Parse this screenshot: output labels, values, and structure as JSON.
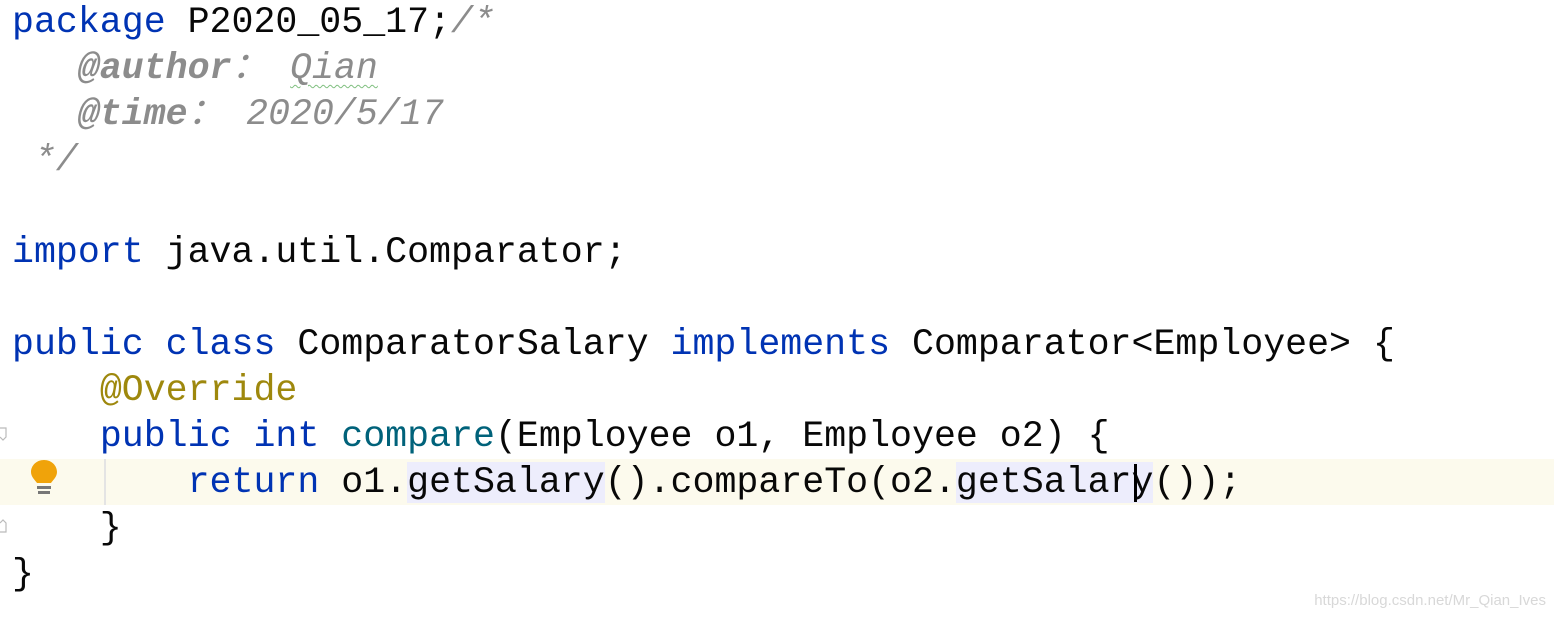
{
  "editor": {
    "lines": [
      [
        {
          "t": "package",
          "c": "kw"
        },
        {
          "t": " P2020_05_17;"
        },
        {
          "t": "/*",
          "c": "cm"
        }
      ],
      [
        {
          "t": "   "
        },
        {
          "t": "@author",
          "c": "cmtag"
        },
        {
          "t": "： ",
          "c": "cm"
        },
        {
          "t": "Qian",
          "c": "cm typo"
        }
      ],
      [
        {
          "t": "   "
        },
        {
          "t": "@time",
          "c": "cmtag"
        },
        {
          "t": "： 2020/5/17",
          "c": "cm"
        }
      ],
      [
        {
          "t": " */",
          "c": "cm"
        }
      ],
      [],
      [
        {
          "t": "import",
          "c": "kw"
        },
        {
          "t": " java.util.Comparator;"
        }
      ],
      [],
      [
        {
          "t": "public",
          "c": "kw"
        },
        {
          "t": " "
        },
        {
          "t": "class",
          "c": "kw"
        },
        {
          "t": " ComparatorSalary "
        },
        {
          "t": "implements",
          "c": "kw"
        },
        {
          "t": " Comparator<Employee> {"
        }
      ],
      [
        {
          "t": "    "
        },
        {
          "t": "@Override",
          "c": "ann"
        }
      ],
      [
        {
          "t": "    "
        },
        {
          "t": "public",
          "c": "kw"
        },
        {
          "t": " "
        },
        {
          "t": "int",
          "c": "kw"
        },
        {
          "t": " "
        },
        {
          "t": "compare",
          "c": "fn"
        },
        {
          "t": "(Employee o1, Employee o2) {"
        }
      ],
      [
        {
          "t": "        "
        },
        {
          "t": "return",
          "c": "kw"
        },
        {
          "t": " o1."
        },
        {
          "t": "getSalary",
          "c": "hl"
        },
        {
          "t": "().compareTo(o2."
        },
        {
          "t": "getSalary",
          "c": "hl"
        },
        {
          "t": "());"
        }
      ],
      [
        {
          "t": "    }"
        }
      ],
      [
        {
          "t": "}"
        }
      ]
    ],
    "current_line": 11,
    "intention_icon": "lightbulb-icon",
    "colors": {
      "keyword": "#0033b3",
      "annotation": "#9e880d",
      "method": "#00627a",
      "comment": "#8c8c8c",
      "current_line": "#fcfaed",
      "usage_highlight": "#ededfc",
      "bulb": "#f0a30a"
    }
  },
  "watermark": "https://blog.csdn.net/Mr_Qian_Ives"
}
